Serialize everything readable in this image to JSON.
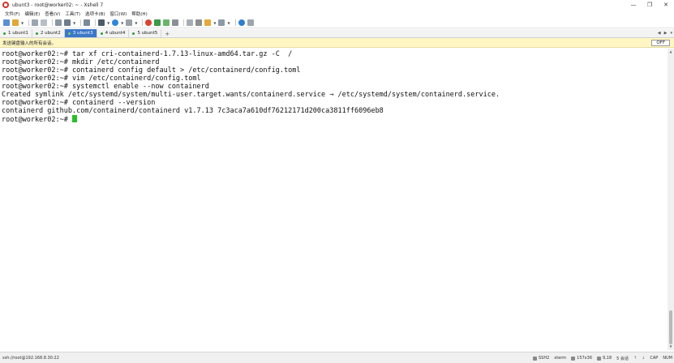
{
  "window": {
    "title": "ubunt3 - root@worker02: ~ - Xshell 7",
    "controls": [
      "—",
      "❐",
      "✕"
    ]
  },
  "menu": [
    "文件(F)",
    "编辑(E)",
    "查看(V)",
    "工具(T)",
    "选项卡(B)",
    "窗口(W)",
    "帮助(H)"
  ],
  "tabs": [
    {
      "label": "1 ubunt1",
      "active": false
    },
    {
      "label": "2 ubunt2",
      "active": false
    },
    {
      "label": "3 ubunt3",
      "active": true
    },
    {
      "label": "4 ubunt4",
      "active": false
    },
    {
      "label": "5 ubunt5",
      "active": false
    }
  ],
  "tab_add": "+",
  "tab_nav": [
    "◀",
    "▶",
    "▾"
  ],
  "notice": {
    "text": "发送键盘输入的所有会话。",
    "button": "OFF"
  },
  "terminal": {
    "lines": [
      "root@worker02:~# tar xf cri-containerd-1.7.13-linux-amd64.tar.gz -C  /",
      "root@worker02:~# mkdir /etc/containerd",
      "root@worker02:~# containerd config default > /etc/containerd/config.toml",
      "root@worker02:~# vim /etc/containerd/config.toml",
      "root@worker02:~# systemctl enable --now containerd",
      "Created symlink /etc/systemd/system/multi-user.target.wants/containerd.service → /etc/systemd/system/containerd.service.",
      "root@worker02:~# containerd --version",
      "containerd github.com/containerd/containerd v1.7.13 7c3aca7a610df76212171d200ca3811ff6096eb8"
    ],
    "prompt": "root@worker02:~# "
  },
  "status": {
    "connection": "ssh://root@192.168.8.30:22",
    "protocol": "SSH2",
    "term_type": "xterm",
    "size": "157x36",
    "cursor_pos": "9,18",
    "sessions": "5 会话",
    "caps": "CAP",
    "num": "NUM"
  },
  "colors": {
    "active_tab": "#3b78c7",
    "notice_bg": "#fff6c4",
    "cursor": "#28c028"
  }
}
